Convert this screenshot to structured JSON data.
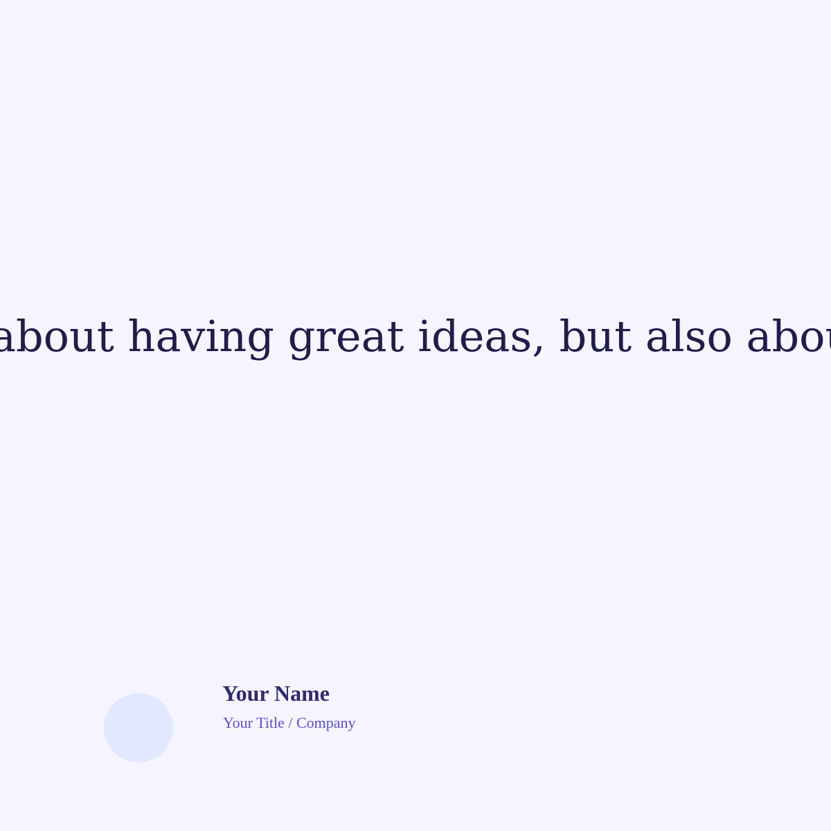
{
  "quote": {
    "text": "about having great ideas, but also about cre"
  },
  "author": {
    "name": "Your Name",
    "title": "Your Title / Company"
  },
  "colors": {
    "background": "#f5f4ff",
    "quote_text": "#1f1d4a",
    "name_text": "#2e2a72",
    "title_text": "#5a50d8",
    "avatar_fill": "#e2e8ff"
  }
}
